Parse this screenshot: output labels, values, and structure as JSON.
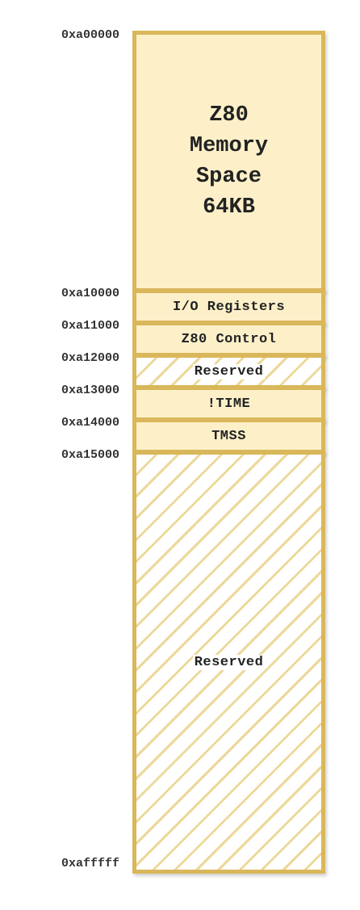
{
  "addresses": [
    "0xa00000",
    "0xa10000",
    "0xa11000",
    "0xa12000",
    "0xa13000",
    "0xa14000",
    "0xa15000",
    "0xafffff"
  ],
  "regions": {
    "z80_memory": {
      "lines": [
        "Z80",
        "Memory",
        "Space",
        "64KB"
      ]
    },
    "io_registers": {
      "label": "I/O Registers"
    },
    "z80_control": {
      "label": "Z80 Control"
    },
    "reserved_1": {
      "label": "Reserved"
    },
    "time": {
      "label": "!TIME"
    },
    "tmss": {
      "label": "TMSS"
    },
    "reserved_2": {
      "label": "Reserved"
    }
  },
  "colors": {
    "border": "#d9b75a",
    "fill": "#fdf0c9",
    "hatch": "#ecd89a",
    "text": "#222222"
  }
}
